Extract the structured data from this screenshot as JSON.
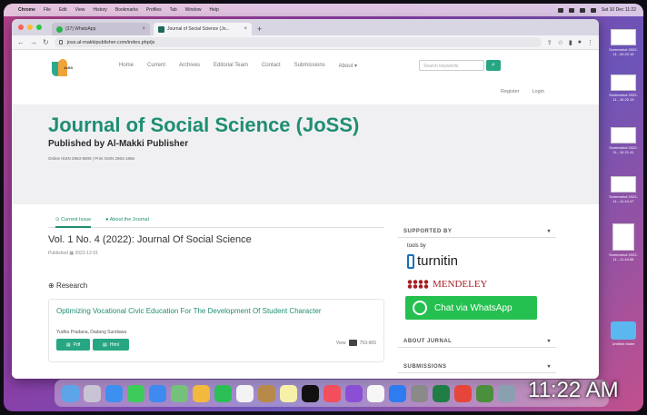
{
  "menubar": {
    "items": [
      "Chrome",
      "File",
      "Edit",
      "View",
      "History",
      "Bookmarks",
      "Profiles",
      "Tab",
      "Window",
      "Help"
    ],
    "datetime": "Sat 10 Dec 11:22"
  },
  "browser": {
    "tabs": [
      {
        "label": "(37) WhatsApp",
        "active": false
      },
      {
        "label": "Journal of Social Science (Jo...",
        "active": true
      }
    ],
    "url": "joss.al-makkipublisher.com/index.php/js"
  },
  "site": {
    "logo_text": "JoSS",
    "nav": [
      "Home",
      "Current",
      "Archives",
      "Editorial Team",
      "Contact",
      "Submissions",
      "About ▾"
    ],
    "search_placeholder": "Search keywords",
    "user_links": [
      "Register",
      "Login"
    ],
    "hero": {
      "title": "Journal of Social Science (JoSS)",
      "subtitle": "Published by Al-Makki Publisher",
      "issn": "Online ISSN 2963-8909 | Print ISSN 2963-1866"
    },
    "content_tabs": [
      "Current Issue",
      "About the Journal"
    ],
    "issue_title": "Vol. 1 No. 4 (2022): Journal Of Social Science",
    "published_label": "Published",
    "published_date": "2022-12-01",
    "section_label": "Research",
    "article": {
      "title": "Optimizing Vocational Civic Education For The Development Of Student Character",
      "authors": "Yudha Pradana, Dadang Sundawa",
      "buttons": [
        "Pdf",
        "Html"
      ],
      "views_label": "View",
      "pages": "753-965"
    },
    "sidebar": {
      "supported_by": "SUPPORTED BY",
      "tools_by": "tools by",
      "turnitin": "turnitin",
      "mendeley": "MENDELEY",
      "whatsapp": "Chat via WhatsApp",
      "about_journal": "ABOUT JURNAL",
      "submissions": "SUBMISSIONS"
    }
  },
  "desktop": {
    "items": [
      {
        "label": "Screenshot 2022-11...20.22.19"
      },
      {
        "label": "Screenshot 2022-11...10.22.19"
      },
      {
        "label": "Screenshot 2022-11...10.21.41"
      },
      {
        "label": "Screenshot 2022-11...11.44.47"
      },
      {
        "label": "Screenshot 2022-11...11.44.58"
      },
      {
        "label": "Untitled folder"
      }
    ]
  },
  "clock": "11:22 AM",
  "colors": {
    "accent": "#1f8e73",
    "whatsapp": "#25c050"
  }
}
